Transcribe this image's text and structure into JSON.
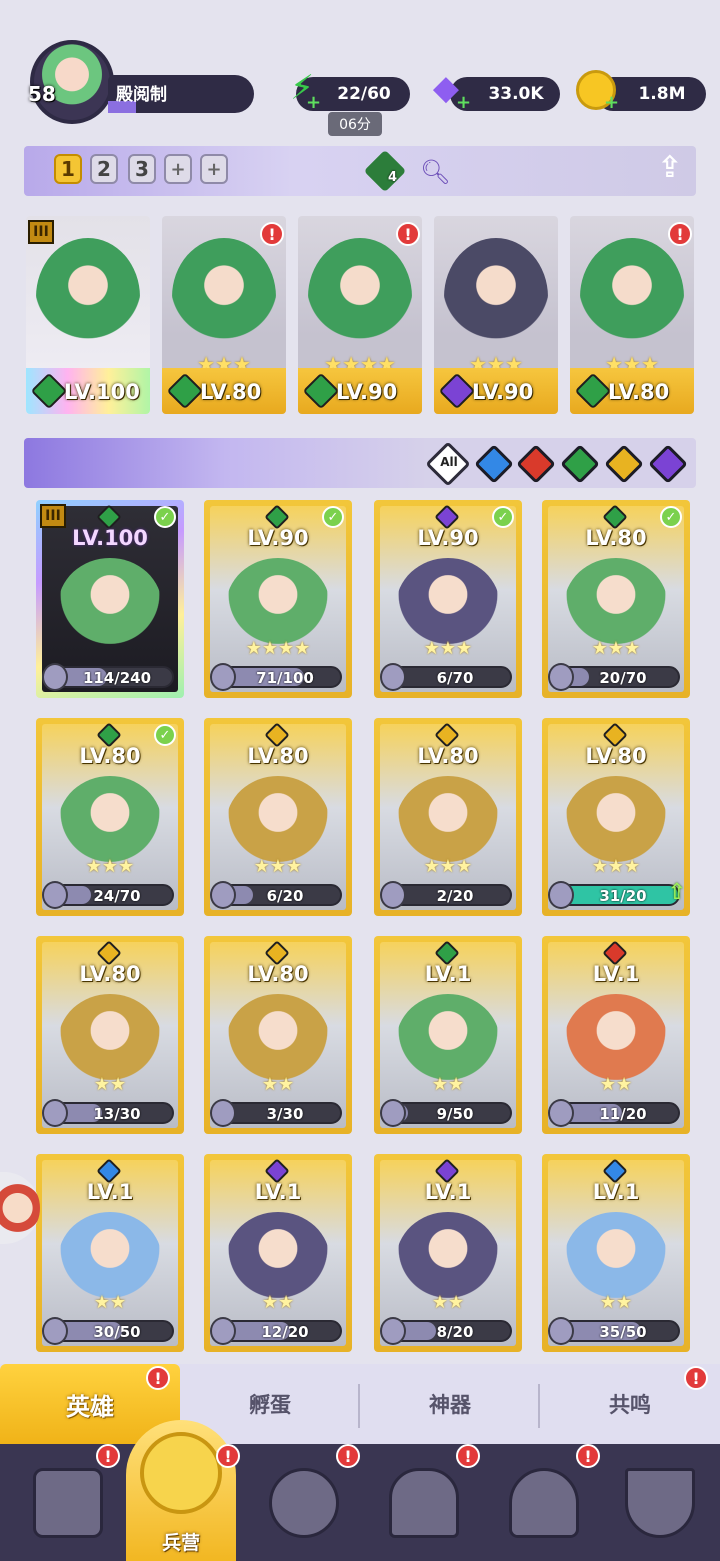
{
  "player": {
    "level": "58",
    "name": "殿阅制",
    "energy": "22/60",
    "energy_timer": "06分",
    "gems": "33.0K",
    "gold": "1.8M"
  },
  "team_bar": {
    "tabs": [
      "1",
      "2",
      "3"
    ],
    "add_tabs": [
      "+",
      "+"
    ],
    "clover_count": "4"
  },
  "team": [
    {
      "level": "LV.100",
      "element": "green",
      "stars": "",
      "tier": "III",
      "alert": false
    },
    {
      "level": "LV.80",
      "element": "green",
      "stars": "★★★",
      "alert": true
    },
    {
      "level": "LV.90",
      "element": "green",
      "stars": "★★★★",
      "alert": true
    },
    {
      "level": "LV.90",
      "element": "purple",
      "stars": "★★★",
      "alert": false
    },
    {
      "level": "LV.80",
      "element": "green",
      "stars": "★★★",
      "alert": true
    }
  ],
  "filter": {
    "all_label": "All",
    "elements": [
      "blue",
      "red",
      "green",
      "gold",
      "purple"
    ]
  },
  "heroes": [
    {
      "level": "LV.100",
      "element": "green",
      "progress": "114/240",
      "ratio": 0.475,
      "stars": "",
      "checked": true,
      "selected": true,
      "tier": "III"
    },
    {
      "level": "LV.90",
      "element": "green",
      "progress": "71/100",
      "ratio": 0.71,
      "stars": "★★★★",
      "checked": true
    },
    {
      "level": "LV.90",
      "element": "purple",
      "progress": "6/70",
      "ratio": 0.086,
      "stars": "★★★",
      "checked": true
    },
    {
      "level": "LV.80",
      "element": "green",
      "progress": "20/70",
      "ratio": 0.286,
      "stars": "★★★",
      "checked": true
    },
    {
      "level": "LV.80",
      "element": "green",
      "progress": "24/70",
      "ratio": 0.343,
      "stars": "★★★",
      "checked": true
    },
    {
      "level": "LV.80",
      "element": "gold",
      "progress": "6/20",
      "ratio": 0.3,
      "stars": "★★★"
    },
    {
      "level": "LV.80",
      "element": "gold",
      "progress": "2/20",
      "ratio": 0.1,
      "stars": "★★★"
    },
    {
      "level": "LV.80",
      "element": "gold",
      "progress": "31/20",
      "ratio": 1.0,
      "stars": "★★★",
      "upgrade": true
    },
    {
      "level": "LV.80",
      "element": "gold",
      "progress": "13/30",
      "ratio": 0.433,
      "stars": "★★"
    },
    {
      "level": "LV.80",
      "element": "gold",
      "progress": "3/30",
      "ratio": 0.1,
      "stars": "★★"
    },
    {
      "level": "LV.1",
      "element": "green",
      "progress": "9/50",
      "ratio": 0.18,
      "stars": "★★"
    },
    {
      "level": "LV.1",
      "element": "red",
      "progress": "11/20",
      "ratio": 0.55,
      "stars": "★★"
    },
    {
      "level": "LV.1",
      "element": "blue",
      "progress": "30/50",
      "ratio": 0.6,
      "stars": "★★"
    },
    {
      "level": "LV.1",
      "element": "purple",
      "progress": "12/20",
      "ratio": 0.6,
      "stars": "★★"
    },
    {
      "level": "LV.1",
      "element": "purple",
      "progress": "8/20",
      "ratio": 0.4,
      "stars": "★★"
    },
    {
      "level": "LV.1",
      "element": "blue",
      "progress": "35/50",
      "ratio": 0.7,
      "stars": "★★"
    }
  ],
  "subtabs": [
    {
      "label": "英雄",
      "active": true,
      "alert": true
    },
    {
      "label": "孵蛋",
      "active": false,
      "alert": false
    },
    {
      "label": "神器",
      "active": false,
      "alert": false
    },
    {
      "label": "共鸣",
      "active": false,
      "alert": true
    }
  ],
  "bottom_nav": {
    "active_label": "兵营",
    "items": [
      "cards-icon",
      "barracks-icon",
      "map-icon",
      "castle-icon",
      "mushroom-icon",
      "guild-icon"
    ]
  },
  "colors": {
    "green": "#2fa047",
    "purple": "#7b43d4",
    "gold": "#e8b321",
    "red": "#d93a2b",
    "blue": "#3388e6",
    "alert": "#e23a3a",
    "accent": "#f4c534"
  }
}
